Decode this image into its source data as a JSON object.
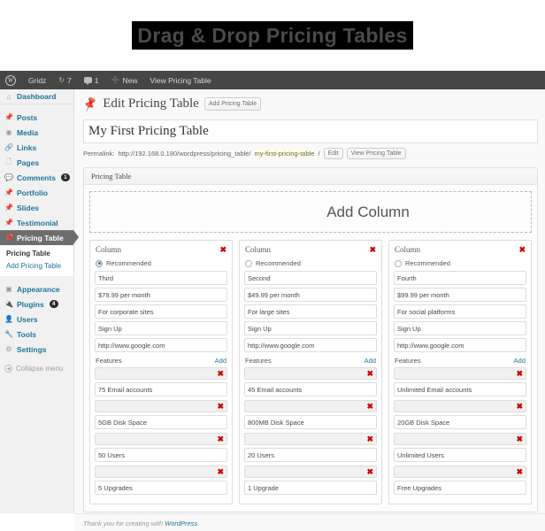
{
  "banner": {
    "title": "Drag & Drop Pricing Tables"
  },
  "adminbar": {
    "logo_icon": "wordpress-logo-icon",
    "site_name": "Gridz",
    "updates_icon": "refresh-icon",
    "updates_count": "7",
    "comments_icon": "comment-bubble-icon",
    "comments_count": "1",
    "new_icon": "plus-icon",
    "new_label": "New",
    "view_label": "View Pricing Table"
  },
  "sidebar": {
    "items": [
      {
        "label": "Dashboard",
        "icon": "dashboard-icon",
        "badge": null,
        "active": false
      },
      {
        "label": "Posts",
        "icon": "pin-icon",
        "badge": null,
        "active": false
      },
      {
        "label": "Media",
        "icon": "media-icon",
        "badge": null,
        "active": false
      },
      {
        "label": "Links",
        "icon": "link-icon",
        "badge": null,
        "active": false
      },
      {
        "label": "Pages",
        "icon": "pages-icon",
        "badge": null,
        "active": false
      },
      {
        "label": "Comments",
        "icon": "comment-bubble-icon",
        "badge": "1",
        "active": false
      },
      {
        "label": "Portfolio",
        "icon": "pin-icon",
        "badge": null,
        "active": false
      },
      {
        "label": "Slides",
        "icon": "pin-icon",
        "badge": null,
        "active": false
      },
      {
        "label": "Testimonial",
        "icon": "pin-icon",
        "badge": null,
        "active": false
      },
      {
        "label": "Pricing Table",
        "icon": "pin-icon",
        "badge": null,
        "active": true
      }
    ],
    "submenu": [
      {
        "label": "Pricing Table",
        "current": true
      },
      {
        "label": "Add Pricing Table",
        "current": false
      }
    ],
    "items2": [
      {
        "label": "Appearance",
        "icon": "appearance-icon",
        "badge": null
      },
      {
        "label": "Plugins",
        "icon": "plugins-icon",
        "badge": "4"
      },
      {
        "label": "Users",
        "icon": "users-icon",
        "badge": null
      },
      {
        "label": "Tools",
        "icon": "tools-icon",
        "badge": null
      },
      {
        "label": "Settings",
        "icon": "settings-icon",
        "badge": null
      }
    ],
    "collapse_label": "Collapse menu",
    "collapse_icon": "chevron-left-icon"
  },
  "page": {
    "heading_icon": "pin-icon",
    "heading": "Edit Pricing Table",
    "add_button": "Add Pricing Table",
    "title_value": "My First Pricing Table",
    "permalink_label": "Permalink:",
    "permalink_url": "http://192.168.0.180/wordpress/pricing_table/",
    "permalink_slug": "my-first-pricing-table",
    "permalink_trailing": "/",
    "edit_button": "Edit",
    "view_button": "View Pricing Table"
  },
  "metabox": {
    "title": "Pricing Table",
    "add_column_label": "Add Column"
  },
  "columns": [
    {
      "header": "Column",
      "remove_icon": "remove-x-icon",
      "recommended_label": "Recommended",
      "recommended": true,
      "name": "Third",
      "price": "$79.99 per month",
      "description": "For corporate sites",
      "button_text": "Sign Up",
      "url": "http://www.google.com",
      "features_label": "Features",
      "features_add": "Add",
      "features": [
        "75 Email accounts",
        "5GB Disk Space",
        "50 Users",
        "5 Upgrades"
      ]
    },
    {
      "header": "Column",
      "remove_icon": "remove-x-icon",
      "recommended_label": "Recommended",
      "recommended": false,
      "name": "Second",
      "price": "$49.99 per month",
      "description": "For large sites",
      "button_text": "Sign Up",
      "url": "http://www.google.com",
      "features_label": "Features",
      "features_add": "Add",
      "features": [
        "45 Email accounts",
        "800MB Disk Space",
        "20 Users",
        "1 Upgrade"
      ]
    },
    {
      "header": "Column",
      "remove_icon": "remove-x-icon",
      "recommended_label": "Recommended",
      "recommended": false,
      "name": "Fourth",
      "price": "$99.99 per month",
      "description": "For social platforms",
      "button_text": "Sign Up",
      "url": "http://www.google.com",
      "features_label": "Features",
      "features_add": "Add",
      "features": [
        "Unlimited Email accounts",
        "20GB Disk Space",
        "Unlimited Users",
        "Free Upgrades"
      ]
    }
  ],
  "footer": {
    "text": "Thank you for creating with ",
    "link": "WordPress",
    "suffix": "."
  },
  "colors": {
    "accent_link": "#21759b",
    "adminbar_bg": "#464646",
    "active_menu_bg": "#6d6d6d",
    "remove_red": "#cc0000",
    "slug_highlight": "#ffffe0"
  }
}
